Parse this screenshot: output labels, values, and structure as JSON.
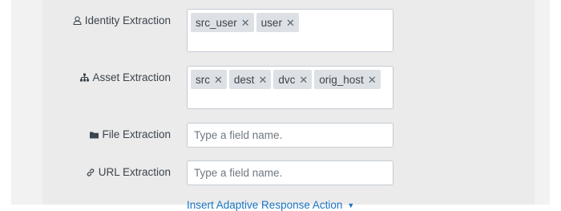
{
  "identity_extraction": {
    "label": "Identity Extraction",
    "tags": [
      "src_user",
      "user"
    ]
  },
  "asset_extraction": {
    "label": "Asset Extraction",
    "tags": [
      "src",
      "dest",
      "dvc",
      "orig_host"
    ]
  },
  "file_extraction": {
    "label": "File Extraction",
    "placeholder": "Type a field name."
  },
  "url_extraction": {
    "label": "URL Extraction",
    "placeholder": "Type a field name."
  },
  "insert_action_link": {
    "label": "Insert Adaptive Response Action"
  },
  "remove_glyph": "✕"
}
